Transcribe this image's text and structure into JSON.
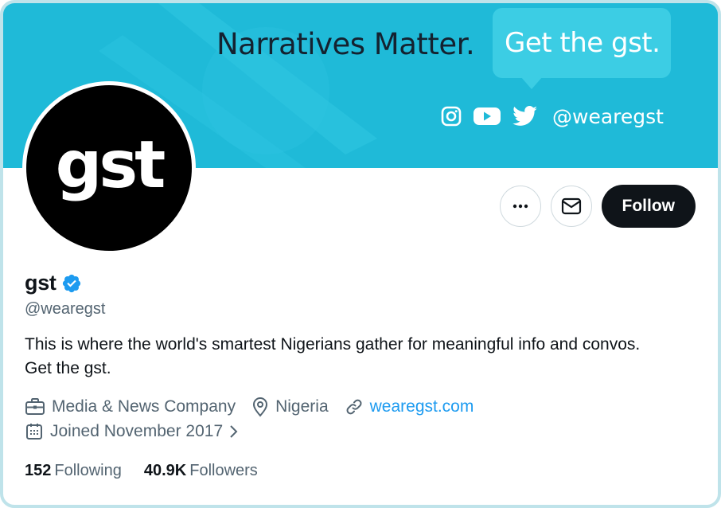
{
  "banner": {
    "headline": "Narratives Matter.",
    "bubble_text": "Get the gst.",
    "social_handle": "@wearegst",
    "background_color": "#1fbad8",
    "social_icons": [
      "instagram-icon",
      "youtube-icon",
      "twitter-icon"
    ]
  },
  "avatar": {
    "text": "gst"
  },
  "actions": {
    "more_icon": "more-icon",
    "message_icon": "mail-icon",
    "follow_label": "Follow"
  },
  "profile": {
    "name": "gst",
    "verified_icon": "verified-badge-icon",
    "handle": "@wearegst",
    "bio": "This is where the world's smartest Nigerians gather for meaningful info and convos. Get the gst.",
    "category": "Media & News Company",
    "location": "Nigeria",
    "website": "wearegst.com",
    "joined": "Joined November 2017",
    "link_color": "#1d9bf0"
  },
  "stats": {
    "following_count": "152",
    "following_label": "Following",
    "followers_count": "40.9K",
    "followers_label": "Followers"
  }
}
